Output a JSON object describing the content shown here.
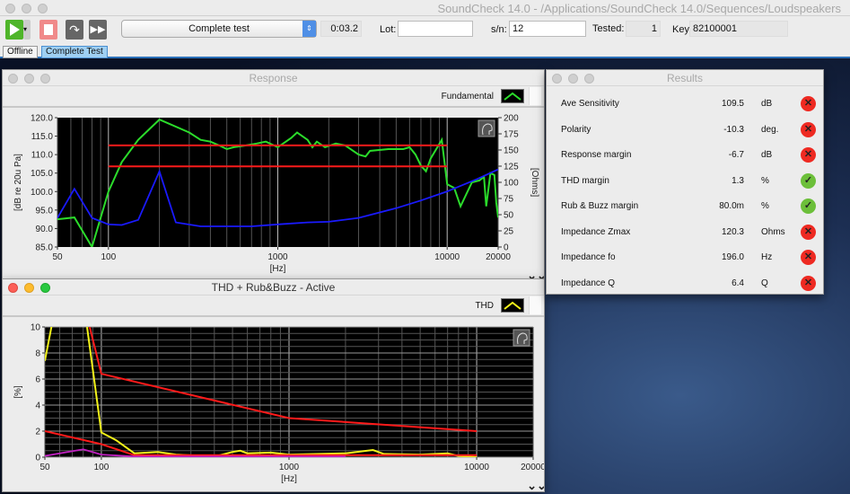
{
  "app": {
    "title": "SoundCheck 14.0  - /Applications/SoundCheck 14.0/Sequences/Loudspeakers"
  },
  "toolbar": {
    "sequence": "Complete test",
    "elapsed": "0:03.2",
    "lot_label": "Lot:",
    "lot_value": "",
    "sn_label": "s/n:",
    "sn_value": "12",
    "tested_label": "Tested:",
    "tested_value": "1",
    "key_label": "Key",
    "key_value": "82100001",
    "play_color": "#4fb52a",
    "stop_color": "#f08a8a"
  },
  "tabs": [
    {
      "label": "Offline",
      "active": false
    },
    {
      "label": "Complete Test",
      "active": true
    }
  ],
  "response": {
    "title": "Response",
    "legend": "Fundamental",
    "legend_color": "#2bdc2b"
  },
  "thd": {
    "title": "THD + Rub&Buzz - Active",
    "legend": "THD",
    "legend_color": "#f2f21a"
  },
  "results": {
    "title": "Results",
    "rows": [
      {
        "name": "Ave Sensitivity",
        "value": "109.5",
        "unit": "dB",
        "pass": false
      },
      {
        "name": "Polarity",
        "value": "-10.3",
        "unit": "deg.",
        "pass": false
      },
      {
        "name": "Response margin",
        "value": "-6.7",
        "unit": "dB",
        "pass": false
      },
      {
        "name": "THD margin",
        "value": "1.3",
        "unit": "%",
        "pass": true
      },
      {
        "name": "Rub & Buzz margin",
        "value": "80.0m",
        "unit": "%",
        "pass": true
      },
      {
        "name": "Impedance Zmax",
        "value": "120.3",
        "unit": "Ohms",
        "pass": false
      },
      {
        "name": "Impedance fo",
        "value": "196.0",
        "unit": "Hz",
        "pass": false
      },
      {
        "name": "Impedance Q",
        "value": "6.4",
        "unit": "Q",
        "pass": false
      }
    ]
  },
  "chart_data": [
    {
      "type": "line",
      "xscale": "log",
      "xlim": [
        50,
        20000
      ],
      "ylim": [
        85,
        120
      ],
      "y2lim": [
        0,
        200
      ],
      "xlabel": "[Hz]",
      "ylabel": "[dB re 20u Pa]",
      "y2label": "[Ohms]",
      "xticks": [
        "50",
        "100",
        "1000",
        "10000",
        "20000"
      ],
      "yticks": [
        "85.0",
        "90.0",
        "95.0",
        "100.0",
        "105.0",
        "110.0",
        "115.0",
        "120.0"
      ],
      "y2ticks": [
        "0",
        "25",
        "50",
        "75",
        "100",
        "125",
        "150",
        "175",
        "200"
      ],
      "series": [
        {
          "name": "Fundamental",
          "color": "#2bdc2b",
          "axis": "left",
          "points": [
            [
              50,
              92.5
            ],
            [
              63,
              93
            ],
            [
              80,
              85
            ],
            [
              100,
              100
            ],
            [
              120,
              108
            ],
            [
              150,
              114
            ],
            [
              200,
              119.5
            ],
            [
              300,
              116
            ],
            [
              350,
              114
            ],
            [
              400,
              113.5
            ],
            [
              450,
              112.5
            ],
            [
              500,
              111.5
            ],
            [
              550,
              112
            ],
            [
              650,
              112.5
            ],
            [
              750,
              113
            ],
            [
              850,
              113.5
            ],
            [
              1000,
              112
            ],
            [
              1200,
              114.5
            ],
            [
              1300,
              116
            ],
            [
              1500,
              114
            ],
            [
              1600,
              112
            ],
            [
              1700,
              113.5
            ],
            [
              1900,
              112
            ],
            [
              2200,
              113
            ],
            [
              2500,
              112.5
            ],
            [
              3000,
              110
            ],
            [
              3300,
              109.5
            ],
            [
              3500,
              111
            ],
            [
              4500,
              111.5
            ],
            [
              5500,
              111.5
            ],
            [
              6000,
              112
            ],
            [
              6500,
              110
            ],
            [
              7000,
              107
            ],
            [
              7500,
              105.5
            ],
            [
              8000,
              109
            ],
            [
              9300,
              114
            ],
            [
              10000,
              102
            ],
            [
              11000,
              101
            ],
            [
              12000,
              96
            ],
            [
              14000,
              102.5
            ],
            [
              15500,
              103
            ],
            [
              16500,
              104
            ],
            [
              17000,
              96
            ],
            [
              18000,
              105
            ],
            [
              19000,
              104.5
            ],
            [
              19500,
              97
            ],
            [
              20000,
              93
            ]
          ]
        },
        {
          "color": "#1a1aff",
          "axis": "right",
          "points": [
            [
              50,
              45
            ],
            [
              63,
              90
            ],
            [
              80,
              45
            ],
            [
              100,
              35
            ],
            [
              120,
              34
            ],
            [
              150,
              42
            ],
            [
              200,
              117
            ],
            [
              250,
              38
            ],
            [
              350,
              32
            ],
            [
              700,
              32
            ],
            [
              1000,
              35
            ],
            [
              1500,
              38
            ],
            [
              2000,
              39
            ],
            [
              3000,
              45
            ],
            [
              5000,
              60
            ],
            [
              7000,
              72
            ],
            [
              10000,
              86
            ],
            [
              15000,
              105
            ],
            [
              20000,
              120
            ]
          ]
        },
        {
          "color": "#ff1a1a",
          "axis": "left",
          "points": [
            [
              100,
              112.5
            ],
            [
              10000,
              112.5
            ]
          ]
        },
        {
          "color": "#ff1a1a",
          "axis": "left",
          "points": [
            [
              100,
              106.8
            ],
            [
              10000,
              106.8
            ]
          ]
        }
      ]
    },
    {
      "type": "line",
      "xscale": "log",
      "xlim": [
        50,
        20000
      ],
      "ylim": [
        0,
        10
      ],
      "xlabel": "[Hz]",
      "ylabel": "[%]",
      "xticks": [
        "50",
        "100",
        "1000",
        "10000",
        "20000"
      ],
      "yticks": [
        "0",
        "2",
        "4",
        "6",
        "8",
        "10"
      ],
      "series": [
        {
          "name": "THD",
          "color": "#f2f21a",
          "points": [
            [
              50,
              7.4
            ],
            [
              55,
              10.5
            ],
            [
              83,
              10.5
            ],
            [
              100,
              1.9
            ],
            [
              120,
              1.3
            ],
            [
              150,
              0.3
            ],
            [
              200,
              0.4
            ],
            [
              250,
              0.2
            ],
            [
              400,
              0.05
            ],
            [
              500,
              0.4
            ],
            [
              550,
              0.5
            ],
            [
              600,
              0.3
            ],
            [
              800,
              0.35
            ],
            [
              1000,
              0.2
            ],
            [
              2000,
              0.3
            ],
            [
              2800,
              0.55
            ],
            [
              3200,
              0.25
            ],
            [
              5000,
              0.2
            ],
            [
              7000,
              0.3
            ],
            [
              8000,
              0.1
            ],
            [
              10000,
              0.0
            ]
          ]
        },
        {
          "color": "#ff1a1a",
          "points": [
            [
              80,
              12
            ],
            [
              100,
              6.4
            ],
            [
              1000,
              3
            ],
            [
              10000,
              2
            ]
          ]
        },
        {
          "color": "#ff1a1a",
          "points": [
            [
              50,
              2
            ],
            [
              100,
              1
            ],
            [
              150,
              0.15
            ],
            [
              10000,
              0.15
            ]
          ]
        },
        {
          "color": "#c020c0",
          "points": [
            [
              50,
              0.1
            ],
            [
              80,
              0.6
            ],
            [
              100,
              0.2
            ],
            [
              150,
              0.05
            ],
            [
              2000,
              0.05
            ]
          ]
        }
      ]
    }
  ]
}
